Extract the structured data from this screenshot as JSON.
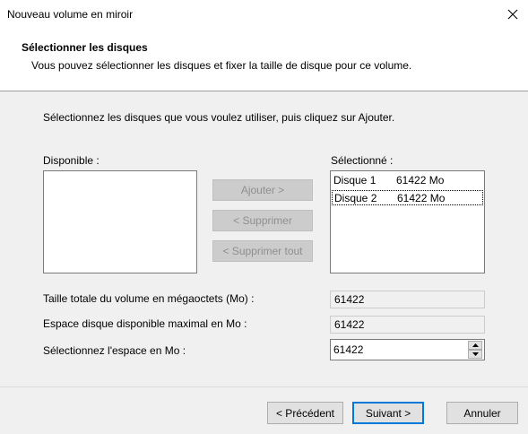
{
  "window": {
    "title": "Nouveau volume en miroir"
  },
  "header": {
    "title": "Sélectionner les disques",
    "subtitle": "Vous pouvez sélectionner les disques et fixer la taille de disque pour ce volume."
  },
  "content": {
    "instruction": "Sélectionnez les disques que vous voulez utiliser, puis cliquez sur Ajouter.",
    "available_label": "Disponible :",
    "selected_label": "Sélectionné :",
    "available_items": [],
    "selected_items": [
      {
        "disk": "Disque 1",
        "size": "61422 Mo"
      },
      {
        "disk": "Disque 2",
        "size": "61422 Mo"
      }
    ],
    "buttons": {
      "add": "Ajouter >",
      "remove": "< Supprimer",
      "remove_all": "< Supprimer tout"
    },
    "total_label": "Taille totale du volume en mégaoctets (Mo) :",
    "total_value": "61422",
    "max_label": "Espace disque disponible maximal en Mo :",
    "max_value": "61422",
    "space_label": "Sélectionnez l'espace en Mo :",
    "space_value": "61422"
  },
  "footer": {
    "back": "< Précédent",
    "next": "Suivant >",
    "cancel": "Annuler"
  },
  "colors": {
    "content_bg": "#f0f0f0",
    "default_button_border": "#0078d7",
    "disabled_text": "#8f8f8f"
  }
}
